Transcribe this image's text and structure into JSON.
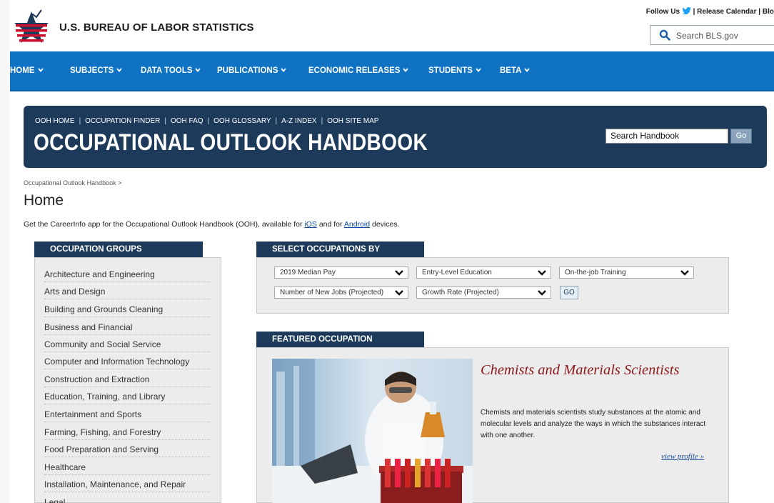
{
  "header": {
    "agency_name": "U.S. BUREAU OF LABOR STATISTICS",
    "follow_us": "Follow Us",
    "release_calendar": "| Release Calendar | Blo",
    "search_placeholder": "Search BLS.gov"
  },
  "nav": {
    "items": [
      "HOME",
      "SUBJECTS",
      "DATA TOOLS",
      "PUBLICATIONS",
      "ECONOMIC RELEASES",
      "STUDENTS",
      "BETA"
    ]
  },
  "banner": {
    "links": [
      "OOH HOME",
      "OCCUPATION FINDER",
      "OOH FAQ",
      "OOH GLOSSARY",
      "A-Z INDEX",
      "OOH SITE MAP"
    ],
    "title": "OCCUPATIONAL OUTLOOK HANDBOOK",
    "search_value": "Search Handbook",
    "go_label": "Go"
  },
  "breadcrumb": "Occupational Outlook Handbook >",
  "page_title": "Home",
  "intro": {
    "before": "Get the CareerInfo app for the Occupational Outlook Handbook (OOH), available for ",
    "ios": "iOS",
    "middle": " and for ",
    "android": "Android",
    "after": " devices."
  },
  "occupation_groups": {
    "heading": "OCCUPATION GROUPS",
    "items": [
      "Architecture and Engineering",
      "Arts and Design",
      "Building and Grounds Cleaning",
      "Business and Financial",
      "Community and Social Service",
      "Computer and Information Technology",
      "Construction and Extraction",
      "Education, Training, and Library",
      "Entertainment and Sports",
      "Farming, Fishing, and Forestry",
      "Food Preparation and Serving",
      "Healthcare",
      "Installation, Maintenance, and Repair",
      "Legal"
    ]
  },
  "select_occupations": {
    "heading": "SELECT OCCUPATIONS BY",
    "selects": [
      "2019 Median Pay",
      "Entry-Level Education",
      "On-the-job Training",
      "Number of New Jobs (Projected)",
      "Growth Rate (Projected)"
    ],
    "go_label": "GO"
  },
  "featured": {
    "heading": "FEATURED OCCUPATION",
    "title": "Chemists and Materials Scientists",
    "description": "Chemists and materials scientists study substances at the atomic and molecular levels and analyze the ways in which the substances interact with one another.",
    "link": "view profile »"
  },
  "colors": {
    "nav_blue": "#0f72c2",
    "banner_navy": "#1d3a5a",
    "featured_title": "#8b1a1a"
  }
}
